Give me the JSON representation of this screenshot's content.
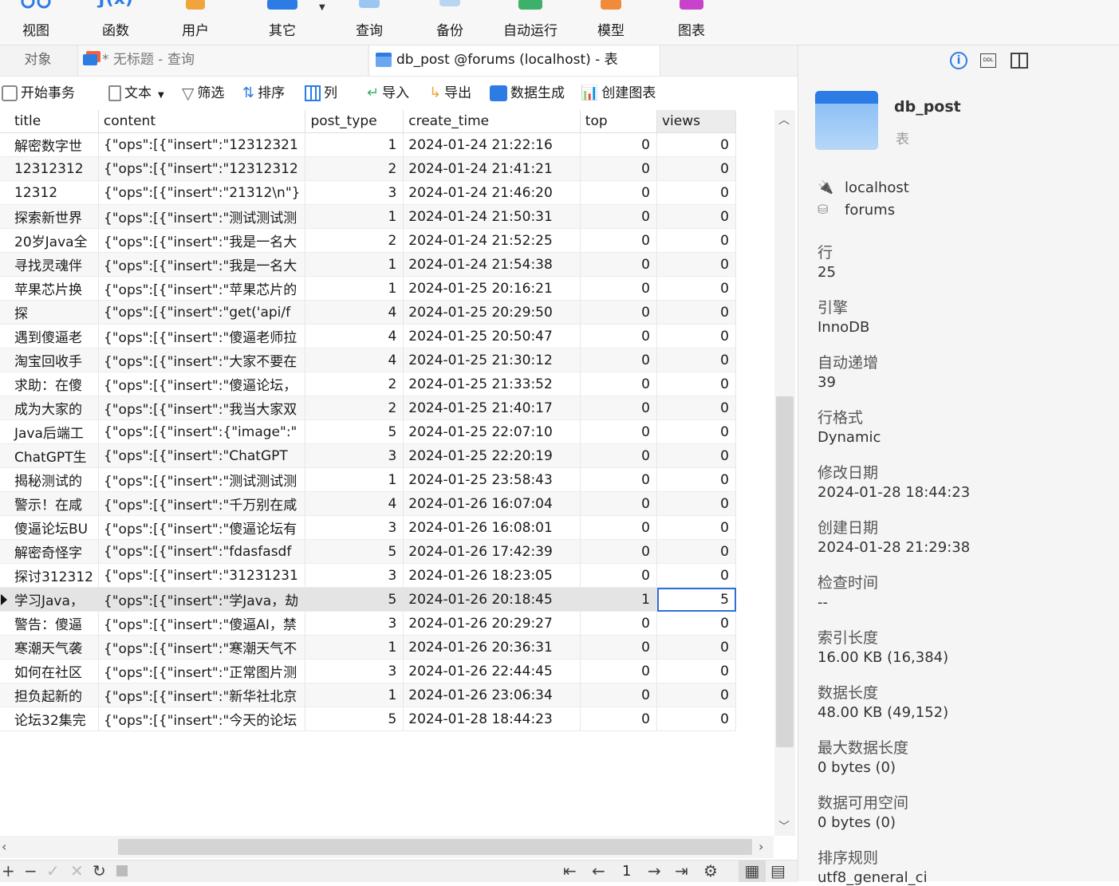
{
  "ribbon": {
    "items": [
      {
        "label": "视图",
        "icon": "view-icon",
        "color": "#2d7be5"
      },
      {
        "label": "函数",
        "icon": "function-icon",
        "color": "#2d7be5"
      },
      {
        "label": "用户",
        "icon": "user-icon",
        "color": "#f2a43c"
      },
      {
        "label": "其它",
        "icon": "other-icon",
        "color": "#2d7be5"
      },
      {
        "label": "查询",
        "icon": "query-icon",
        "color": "#7fb5ef"
      },
      {
        "label": "备份",
        "icon": "backup-icon",
        "color": "#9dc4ee"
      },
      {
        "label": "自动运行",
        "icon": "autorun-icon",
        "color": "#3db06a"
      },
      {
        "label": "模型",
        "icon": "model-icon",
        "color": "#f28a3c"
      },
      {
        "label": "图表",
        "icon": "chart-icon",
        "color": "#c743c9"
      }
    ]
  },
  "tabs": {
    "objects": "对象",
    "untitled": "* 无标题 - 查询",
    "active": "db_post @forums (localhost) - 表"
  },
  "toolbar": {
    "begin_tx": "开始事务",
    "text": "文本",
    "filter": "筛选",
    "sort": "排序",
    "columns": "列",
    "import": "导入",
    "export": "导出",
    "datagen": "数据生成",
    "create_chart": "创建图表"
  },
  "grid": {
    "columns": [
      "title",
      "content",
      "post_type",
      "create_time",
      "top",
      "views"
    ],
    "rows": [
      [
        "解密数字世",
        "{\"ops\":[{\"insert\":\"12312321",
        "1",
        "2024-01-24 21:22:16",
        "0",
        "0"
      ],
      [
        "12312312",
        "{\"ops\":[{\"insert\":\"12312312",
        "2",
        "2024-01-24 21:41:21",
        "0",
        "0"
      ],
      [
        "12312",
        "{\"ops\":[{\"insert\":\"21312\\n\"}",
        "3",
        "2024-01-24 21:46:20",
        "0",
        "0"
      ],
      [
        "探索新世界",
        "{\"ops\":[{\"insert\":\"测试测试测",
        "1",
        "2024-01-24 21:50:31",
        "0",
        "0"
      ],
      [
        "20岁Java全",
        "{\"ops\":[{\"insert\":\"我是一名大",
        "2",
        "2024-01-24 21:52:25",
        "0",
        "0"
      ],
      [
        "寻找灵魂伴",
        "{\"ops\":[{\"insert\":\"我是一名大",
        "1",
        "2024-01-24 21:54:38",
        "0",
        "0"
      ],
      [
        "苹果芯片换",
        "{\"ops\":[{\"insert\":\"苹果芯片的",
        "1",
        "2024-01-25 20:16:21",
        "0",
        "0"
      ],
      [
        "探",
        "{\"ops\":[{\"insert\":\"get('api/f",
        "4",
        "2024-01-25 20:29:50",
        "0",
        "0"
      ],
      [
        "遇到傻逼老",
        "{\"ops\":[{\"insert\":\"傻逼老师拉",
        "4",
        "2024-01-25 20:50:47",
        "0",
        "0"
      ],
      [
        "淘宝回收手",
        "{\"ops\":[{\"insert\":\"大家不要在",
        "4",
        "2024-01-25 21:30:12",
        "0",
        "0"
      ],
      [
        "求助：在傻",
        "{\"ops\":[{\"insert\":\"傻逼论坛，",
        "2",
        "2024-01-25 21:33:52",
        "0",
        "0"
      ],
      [
        "成为大家的",
        "{\"ops\":[{\"insert\":\"我当大家双",
        "2",
        "2024-01-25 21:40:17",
        "0",
        "0"
      ],
      [
        "Java后端工",
        "{\"ops\":[{\"insert\":{\"image\":\"",
        "5",
        "2024-01-25 22:07:10",
        "0",
        "0"
      ],
      [
        "ChatGPT生",
        "{\"ops\":[{\"insert\":\"ChatGPT",
        "3",
        "2024-01-25 22:20:19",
        "0",
        "0"
      ],
      [
        "揭秘测试的",
        "{\"ops\":[{\"insert\":\"测试测试测",
        "1",
        "2024-01-25 23:58:43",
        "0",
        "0"
      ],
      [
        "警示！在咸",
        "{\"ops\":[{\"insert\":\"千万别在咸",
        "4",
        "2024-01-26 16:07:04",
        "0",
        "0"
      ],
      [
        "傻逼论坛BU",
        "{\"ops\":[{\"insert\":\"傻逼论坛有",
        "3",
        "2024-01-26 16:08:01",
        "0",
        "0"
      ],
      [
        "解密奇怪字",
        "{\"ops\":[{\"insert\":\"fdasfasdf",
        "5",
        "2024-01-26 17:42:39",
        "0",
        "0"
      ],
      [
        "探讨312312",
        "{\"ops\":[{\"insert\":\"31231231",
        "3",
        "2024-01-26 18:23:05",
        "0",
        "0"
      ],
      [
        "学习Java，",
        "{\"ops\":[{\"insert\":\"学Java，劫",
        "5",
        "2024-01-26 20:18:45",
        "1",
        "5"
      ],
      [
        "警告：傻逼",
        "{\"ops\":[{\"insert\":\"傻逼AI，禁",
        "3",
        "2024-01-26 20:29:27",
        "0",
        "0"
      ],
      [
        "寒潮天气袭",
        "{\"ops\":[{\"insert\":\"寒潮天气不",
        "1",
        "2024-01-26 20:36:31",
        "0",
        "0"
      ],
      [
        "如何在社区",
        "{\"ops\":[{\"insert\":\"正常图片测",
        "3",
        "2024-01-26 22:44:45",
        "0",
        "0"
      ],
      [
        "担负起新的",
        "{\"ops\":[{\"insert\":\"新华社北京",
        "1",
        "2024-01-26 23:06:34",
        "0",
        "0"
      ],
      [
        "论坛32集完",
        "{\"ops\":[{\"insert\":\"今天的论坛",
        "5",
        "2024-01-28 18:44:23",
        "0",
        "0"
      ]
    ],
    "selected_row": 19
  },
  "pager": {
    "page": "1"
  },
  "panel": {
    "name": "db_post",
    "type": "表",
    "connection": "localhost",
    "database": "forums",
    "props": [
      {
        "label": "行",
        "value": "25"
      },
      {
        "label": "引擎",
        "value": "InnoDB"
      },
      {
        "label": "自动递增",
        "value": "39"
      },
      {
        "label": "行格式",
        "value": "Dynamic"
      },
      {
        "label": "修改日期",
        "value": "2024-01-28 18:44:23"
      },
      {
        "label": "创建日期",
        "value": "2024-01-28 21:29:38"
      },
      {
        "label": "检查时间",
        "value": "--"
      },
      {
        "label": "索引长度",
        "value": "16.00 KB (16,384)"
      },
      {
        "label": "数据长度",
        "value": "48.00 KB (49,152)"
      },
      {
        "label": "最大数据长度",
        "value": "0 bytes (0)"
      },
      {
        "label": "数据可用空间",
        "value": "0 bytes (0)"
      },
      {
        "label": "排序规则",
        "value": "utf8_general_ci"
      }
    ]
  },
  "colors": {
    "accent": "#2f6fd6",
    "selected_row": "#e4e4e4",
    "alt_row": "#f7f7f7"
  }
}
